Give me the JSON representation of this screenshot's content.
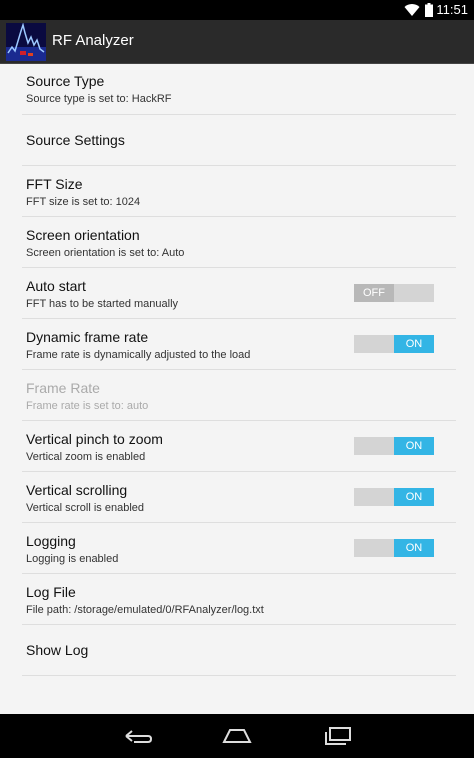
{
  "status_bar": {
    "time": "11:51",
    "icons": [
      "wifi-icon",
      "battery-icon"
    ]
  },
  "action_bar": {
    "title": "RF Analyzer",
    "icon": "app-spectrum-icon"
  },
  "preferences": [
    {
      "title": "Source Type",
      "summary": "Source type is set to: HackRF"
    },
    {
      "title": "Source Settings",
      "summary": ""
    },
    {
      "title": "FFT Size",
      "summary": "FFT size is set to: 1024"
    },
    {
      "title": "Screen orientation",
      "summary": "Screen orientation is set to: Auto"
    },
    {
      "title": "Auto start",
      "summary": "FFT has to be started manually",
      "toggle": "OFF"
    },
    {
      "title": "Dynamic frame rate",
      "summary": "Frame rate is dynamically adjusted to the load",
      "toggle": "ON"
    },
    {
      "title": "Frame Rate",
      "summary": "Frame rate is set to: auto",
      "disabled": true
    },
    {
      "title": "Vertical pinch to zoom",
      "summary": "Vertical zoom is enabled",
      "toggle": "ON"
    },
    {
      "title": "Vertical scrolling",
      "summary": "Vertical scroll is enabled",
      "toggle": "ON"
    },
    {
      "title": "Logging",
      "summary": "Logging is enabled",
      "toggle": "ON"
    },
    {
      "title": "Log File",
      "summary": "File path: /storage/emulated/0/RFAnalyzer/log.txt"
    },
    {
      "title": "Show Log",
      "summary": ""
    }
  ],
  "nav_bar": {
    "icons": [
      "back-icon",
      "home-icon",
      "recents-icon"
    ]
  },
  "colors": {
    "accent": "#33b5e5",
    "action_bar": "#2a2a2a",
    "background": "#f4f4f4"
  }
}
